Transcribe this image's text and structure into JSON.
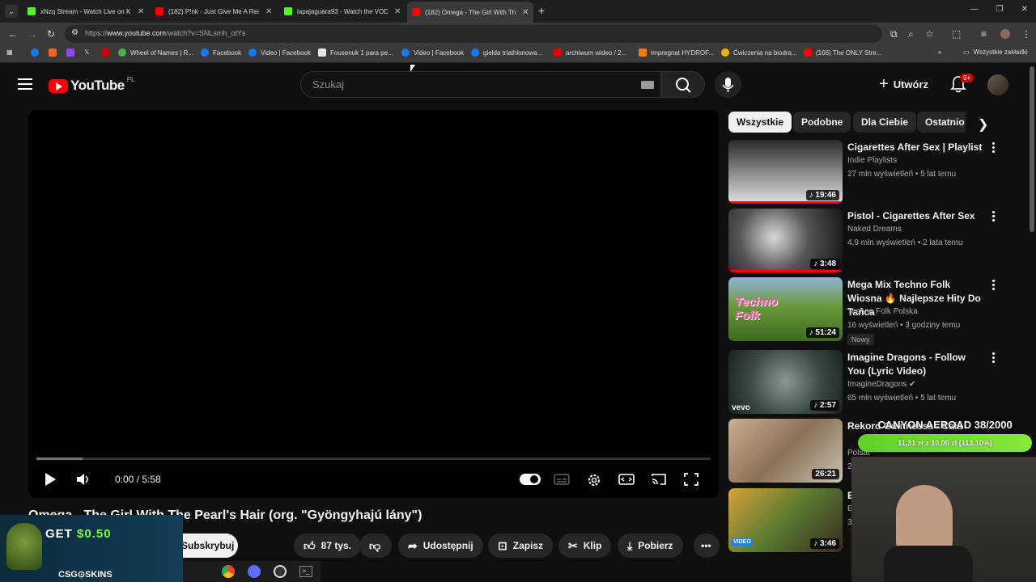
{
  "browser": {
    "tabs": [
      {
        "title": "xNzq Stream - Watch Live on K",
        "color": "#53fc18"
      },
      {
        "title": "(182) P!nk - Just Give Me A Rea",
        "color": "#ff0000"
      },
      {
        "title": "lapajaguara93 - Watch the VOD",
        "color": "#53fc18"
      },
      {
        "title": "(182) Omega - The Girl With Th",
        "color": "#ff0000"
      }
    ],
    "url_prefix": "https://",
    "url_host": "www.youtube.com",
    "url_path": "/watch?v=SNLsmh_otYs",
    "bookmarks": [
      {
        "label": "",
        "color": "#1877f2"
      },
      {
        "label": "",
        "color": "#f26522"
      },
      {
        "label": "",
        "color": "#9146ff"
      },
      {
        "label": "",
        "color": "#e6e6e6"
      },
      {
        "label": "",
        "color": "#cc0000"
      },
      {
        "label": "Wheel of Names | R...",
        "color": "#4caf50"
      },
      {
        "label": "Facebook",
        "color": "#1877f2"
      },
      {
        "label": "Video | Facebook",
        "color": "#1877f2"
      },
      {
        "label": "Fousenuk 1 para pe...",
        "color": "#e6e6e6"
      },
      {
        "label": "Video | Facebook",
        "color": "#1877f2"
      },
      {
        "label": "giełda triathlonowa...",
        "color": "#1877f2"
      },
      {
        "label": "archiwum wideo / 2...",
        "color": "#e00000"
      },
      {
        "label": "Impregnat HYDROF...",
        "color": "#ff7a00"
      },
      {
        "label": "Ćwiczenia na biodra...",
        "color": "#f0b400"
      },
      {
        "label": "(166) The ONLY Stre...",
        "color": "#ff0000"
      }
    ],
    "all_bookmarks": "Wszystkie zakładki"
  },
  "header": {
    "logo": "YouTube",
    "country": "PL",
    "search_placeholder": "Szukaj",
    "create_label": "Utwórz",
    "notif_count": "9+"
  },
  "player": {
    "time": "0:00 / 5:58",
    "progress_buffered": 0.068
  },
  "video": {
    "title": "Omega - The Girl With The Pearl's Hair (org. \"Gyöngyhajú lány\")",
    "subscribe": "Subskrybuj",
    "likes": "87 tys.",
    "share": "Udostępnij",
    "save": "Zapisz",
    "clip": "Klip",
    "download": "Pobierz"
  },
  "chips": [
    "Wszystkie",
    "Podobne",
    "Dla Ciebie",
    "Ostatnio"
  ],
  "recommendations": [
    {
      "title": "Cigarettes After Sex | Playlist",
      "channel": "Indie Playlists",
      "meta": "27 mln wyświetleń • 5 lat temu",
      "duration": "19:46",
      "thumb": "#8a8a8a",
      "new": ""
    },
    {
      "title": "Pistol - Cigarettes After Sex",
      "channel": "Naked Dreams",
      "meta": "4,9 mln wyświetleń • 2 lata temu",
      "duration": "3:48",
      "thumb": "#4a4a4a",
      "new": ""
    },
    {
      "title": "Mega Mix Techno Folk Wiosna 🔥 Najlepsze Hity Do Tańca",
      "channel": "Techno Folk Polska",
      "meta": "16 wyświetleń • 3 godziny temu",
      "duration": "51:24",
      "thumb": "#6a8a3a",
      "new": "Nowy"
    },
    {
      "title": "Imagine Dragons - Follow You (Lyric Video)",
      "channel": "ImagineDragons",
      "meta": "65 mln wyświetleń • 5 lat temu",
      "duration": "2:57",
      "thumb": "#3a4a40",
      "new": ""
    },
    {
      "title": "Rekord Guinnessa - Cała",
      "channel": "Polsat",
      "meta": "21",
      "duration": "26:21",
      "thumb": "#7a6a55",
      "new": ""
    },
    {
      "title": "EL",
      "channel": "Ele",
      "meta": "34",
      "duration": "3:46",
      "thumb": "#5a7a30",
      "new": ""
    }
  ],
  "overlays": {
    "ad_text_prefix": "GET ",
    "ad_amount": "$0.50",
    "ad_brand": "CSG⊙SKINS",
    "stream_title": "CANYON AEROAD 38/2000",
    "stream_progress": "11,31 zł z 10,00 zł (113.10%)",
    "stream_progress_fraction": 1.131
  }
}
